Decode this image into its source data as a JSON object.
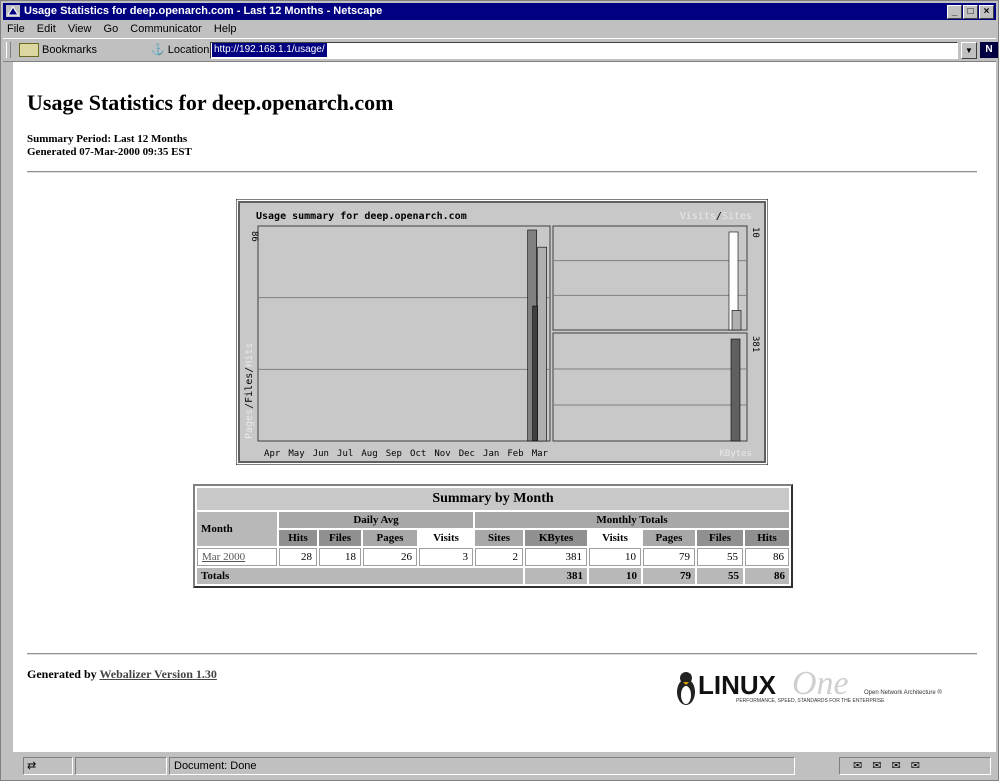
{
  "window": {
    "title": "Usage Statistics for deep.openarch.com - Last 12 Months - Netscape",
    "controls": [
      "_",
      "□",
      "×"
    ]
  },
  "menu": [
    "File",
    "Edit",
    "View",
    "Go",
    "Communicator",
    "Help"
  ],
  "toolbar": {
    "bookmarks_label": "Bookmarks",
    "location_label": "Location:",
    "location_value": "http://192.168.1.1/usage/"
  },
  "page": {
    "title": "Usage Statistics for deep.openarch.com",
    "summary_period": "Summary Period: Last 12 Months",
    "generated": "Generated 07-Mar-2000 09:35 EST"
  },
  "chart_data": {
    "type": "bar",
    "title": "Usage summary for deep.openarch.com",
    "legend_right": {
      "a": "Visits",
      "sep": "/",
      "b": "Sites"
    },
    "ylabel_left": {
      "pages": "Pages",
      "files": "Files",
      "hits": "Hits"
    },
    "categories": [
      "Apr",
      "May",
      "Jun",
      "Jul",
      "Aug",
      "Sep",
      "Oct",
      "Nov",
      "Dec",
      "Jan",
      "Feb",
      "Mar"
    ],
    "left_ymax_label": "86",
    "right_top_max_label": "10",
    "right_bottom_max_label": "381",
    "right_bottom_label": "KBytes",
    "series_left": [
      {
        "name": "Hits",
        "values": [
          0,
          0,
          0,
          0,
          0,
          0,
          0,
          0,
          0,
          0,
          0,
          86
        ],
        "color": "#808080"
      },
      {
        "name": "Files",
        "values": [
          0,
          0,
          0,
          0,
          0,
          0,
          0,
          0,
          0,
          0,
          0,
          55
        ],
        "color": "#404040"
      },
      {
        "name": "Pages",
        "values": [
          0,
          0,
          0,
          0,
          0,
          0,
          0,
          0,
          0,
          0,
          0,
          79
        ],
        "color": "#b0b0b0"
      }
    ],
    "series_right_top": [
      {
        "name": "Visits",
        "values": [
          10
        ],
        "color": "#ffffff"
      },
      {
        "name": "Sites",
        "values": [
          2
        ],
        "color": "#b0b0b0"
      }
    ],
    "series_right_bottom": [
      {
        "name": "KBytes",
        "values": [
          381
        ],
        "color": "#606060"
      }
    ],
    "colors": {
      "bg": "#c8c8c8",
      "frame": "#808080"
    }
  },
  "summary": {
    "heading": "Summary by Month",
    "month_col": "Month",
    "daily_avg": "Daily Avg",
    "monthly_totals": "Monthly Totals",
    "daily_cols": [
      "Hits",
      "Files",
      "Pages",
      "Visits"
    ],
    "monthly_cols": [
      "Sites",
      "KBytes",
      "Visits",
      "Pages",
      "Files",
      "Hits"
    ],
    "row": {
      "month": "Mar 2000",
      "daily": [
        "28",
        "18",
        "26",
        "3"
      ],
      "monthly": [
        "2",
        "381",
        "10",
        "79",
        "55",
        "86"
      ]
    },
    "totals_label": "Totals",
    "totals": [
      "381",
      "10",
      "79",
      "55",
      "86"
    ]
  },
  "footer": {
    "prefix": "Generated by ",
    "link": "Webalizer Version 1.30"
  },
  "logo": {
    "brand": "LINUX",
    "one": "One",
    "tagline1": "Open Network Architecture ®",
    "tagline2": "PERFORMANCE, SPEED, STANDARDS FOR THE ENTERPRISE"
  },
  "status": {
    "text": "Document: Done"
  }
}
